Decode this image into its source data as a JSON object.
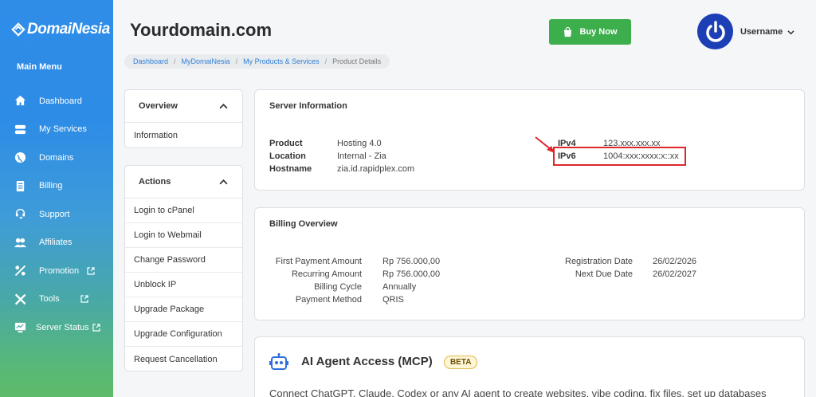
{
  "sidebar": {
    "logo_text": "DomaiNesia",
    "menu_title": "Main Menu",
    "items": [
      {
        "label": "Dashboard",
        "icon": "home-icon"
      },
      {
        "label": "My Services",
        "icon": "server-stack-icon"
      },
      {
        "label": "Domains",
        "icon": "globe-icon"
      },
      {
        "label": "Billing",
        "icon": "invoice-icon"
      },
      {
        "label": "Support",
        "icon": "headset-icon"
      },
      {
        "label": "Affiliates",
        "icon": "users-icon"
      },
      {
        "label": "Promotion",
        "icon": "percent-icon"
      },
      {
        "label": "Tools",
        "icon": "tools-icon"
      },
      {
        "label": "Server Status",
        "icon": "monitor-icon"
      }
    ]
  },
  "header": {
    "title": "Yourdomain.com",
    "buy_label": "Buy Now",
    "username": "Username"
  },
  "breadcrumb": [
    "Dashboard",
    "MyDomaiNesia",
    "My Products & Services",
    "Product Details"
  ],
  "overview": {
    "title": "Overview",
    "items": [
      "Information"
    ]
  },
  "actions": {
    "title": "Actions",
    "items": [
      "Login to cPanel",
      "Login to Webmail",
      "Change Password",
      "Unblock IP",
      "Upgrade Package",
      "Upgrade Configuration",
      "Request Cancellation"
    ]
  },
  "server_info": {
    "title": "Server Information",
    "product_label": "Product",
    "product_value": "Hosting 4.0",
    "location_label": "Location",
    "location_value": "Internal - Zia",
    "hostname_label": "Hostname",
    "hostname_value": "zia.id.rapidplex.com",
    "ipv4_label": "IPv4",
    "ipv4_value": "123.xxx.xxx.xx",
    "ipv6_label": "IPv6",
    "ipv6_value": "1004:xxx:xxxx:x::xx",
    "highlight_color": "#e0262a"
  },
  "billing": {
    "title": "Billing Overview",
    "first_payment_label": "First Payment Amount",
    "first_payment_value": "Rp 756.000,00",
    "recurring_label": "Recurring Amount",
    "recurring_value": "Rp 756.000,00",
    "cycle_label": "Billing Cycle",
    "cycle_value": "Annually",
    "method_label": "Payment Method",
    "method_value": "QRIS",
    "reg_date_label": "Registration Date",
    "reg_date_value": "26/02/2026",
    "due_date_label": "Next Due Date",
    "due_date_value": "26/02/2027"
  },
  "ai": {
    "title": "AI Agent Access (MCP)",
    "badge": "BETA",
    "description": "Connect ChatGPT, Claude, Codex or any AI agent to create websites, vibe coding, fix files, set up databases"
  },
  "colors": {
    "accent": "#2f8de8",
    "buy": "#3dae4c",
    "avatar": "#1c3fb6"
  }
}
